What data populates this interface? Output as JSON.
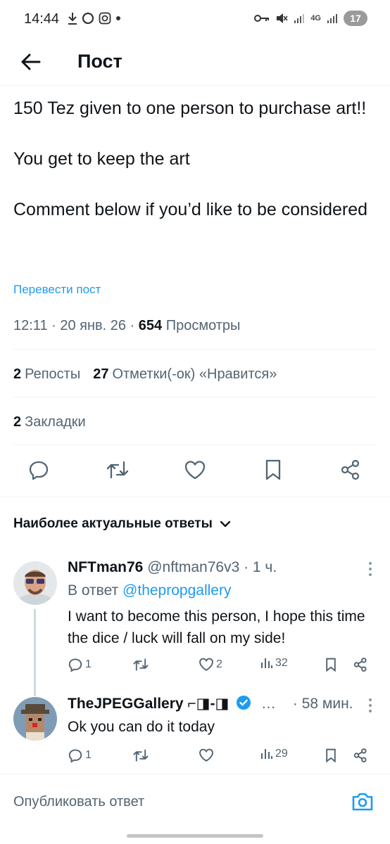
{
  "status_bar": {
    "time": "14:44",
    "network": "4G",
    "battery": "17"
  },
  "header": {
    "title": "Пост"
  },
  "post": {
    "paragraphs": [
      "150 Tez given to one person to purchase art!!",
      "You get to keep the art",
      "Comment below if you’d like to be considered"
    ],
    "translate_label": "Перевести пост",
    "timestamp": "12:11 · 20 янв. 26 · ",
    "views_count": "654",
    "views_label": " Просмотры",
    "reposts_count": "2",
    "reposts_label": "Репосты",
    "likes_count": "27",
    "likes_label": "Отметки(-ок) «Нравится»",
    "bookmarks_count": "2",
    "bookmarks_label": "Закладки"
  },
  "replies_filter": {
    "label": "Наиболее актуальные ответы"
  },
  "replies": [
    {
      "name": "NFTman76",
      "handle": " @nftman76v3 · 1 ч.",
      "reply_to_prefix": "В ответ ",
      "reply_to_handle": "@thepropgallery",
      "text": "I want to become this person, I hope this time the dice / luck will fall on my side!",
      "replies": "1",
      "reposts": "",
      "likes": "2",
      "views": "32"
    },
    {
      "name": "TheJPEGGallery ⌐◨-◨",
      "ellipsis": "…",
      "time": "· 58 мин.",
      "text": "Ok you can do it today",
      "replies": "1",
      "reposts": "",
      "likes": "",
      "views": "29"
    }
  ],
  "compose": {
    "placeholder": "Опубликовать ответ"
  },
  "colors": {
    "accent": "#1d9bf0",
    "text": "#0f1419",
    "muted": "#536471"
  }
}
